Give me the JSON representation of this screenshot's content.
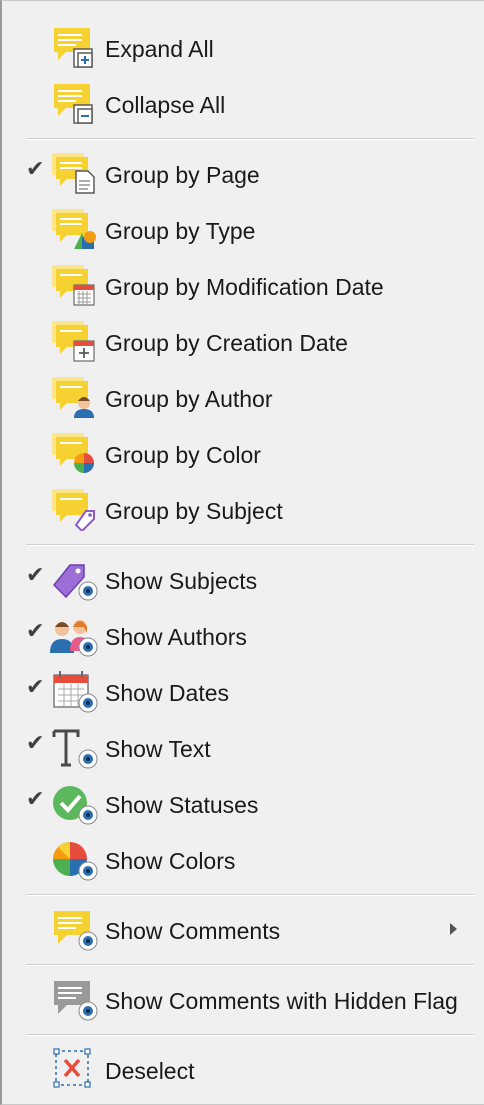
{
  "menu": {
    "expand_all": "Expand All",
    "collapse_all": "Collapse All",
    "group_page": "Group by Page",
    "group_type": "Group by Type",
    "group_mod_date": "Group by Modification Date",
    "group_creation_date": "Group by Creation Date",
    "group_author": "Group by Author",
    "group_color": "Group by Color",
    "group_subject": "Group by Subject",
    "show_subjects": "Show Subjects",
    "show_authors": "Show Authors",
    "show_dates": "Show Dates",
    "show_text": "Show Text",
    "show_statuses": "Show Statuses",
    "show_colors": "Show Colors",
    "show_comments": "Show Comments",
    "show_hidden_flag": "Show Comments with Hidden Flag",
    "deselect": "Deselect"
  },
  "checked": {
    "group_page": true,
    "show_subjects": true,
    "show_authors": true,
    "show_dates": true,
    "show_text": true,
    "show_statuses": true
  },
  "check_glyph": "✔",
  "colors": {
    "note_yellow": "#f5d132",
    "note_light": "#fde58a",
    "eye_blue": "#2a6fb0",
    "check": "#404040"
  }
}
